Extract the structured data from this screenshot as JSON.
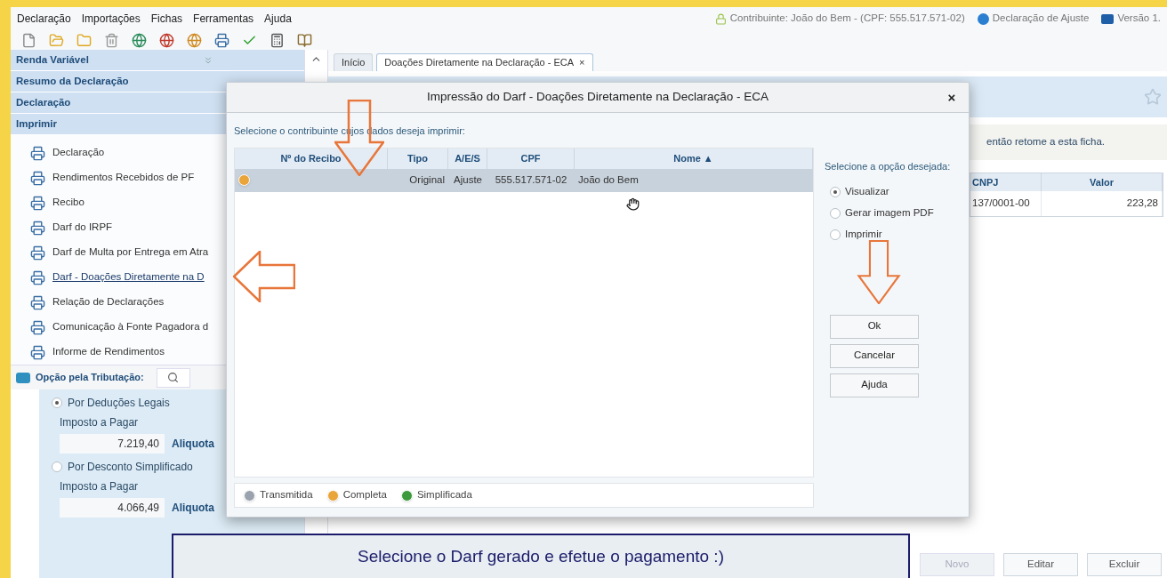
{
  "menu": [
    "Declaração",
    "Importações",
    "Fichas",
    "Ferramentas",
    "Ajuda"
  ],
  "header_info": [
    {
      "kind": "lock",
      "text": "Contribuinte: João do Bem - (CPF: 555.517.571-02)"
    },
    {
      "kind": "badge",
      "text": "Declaração de Ajuste"
    },
    {
      "kind": "version",
      "text": "Versão 1."
    }
  ],
  "sidebar": {
    "sections": [
      {
        "label": "Renda Variável",
        "collapsible": true
      },
      {
        "label": "Resumo da Declaração",
        "collapsible": false
      },
      {
        "label": "Declaração",
        "collapsible": false
      },
      {
        "label": "Imprimir",
        "collapsible": false
      }
    ],
    "items": [
      {
        "label": "Declaração",
        "selected": false
      },
      {
        "label": "Rendimentos Recebidos de PF",
        "selected": false
      },
      {
        "label": "Recibo",
        "selected": false
      },
      {
        "label": "Darf do IRPF",
        "selected": false
      },
      {
        "label": "Darf de Multa por Entrega em Atra",
        "selected": false
      },
      {
        "label": "Darf - Doações Diretamente na D",
        "selected": true
      },
      {
        "label": "Relação de Declarações",
        "selected": false
      },
      {
        "label": "Comunicação à Fonte Pagadora d",
        "selected": false
      },
      {
        "label": "Informe de Rendimentos",
        "selected": false
      }
    ]
  },
  "tributacao": {
    "label": "Opção pela Tributação:",
    "options": [
      {
        "label": "Por Deduções Legais",
        "selected": true,
        "field_label": "Imposto a Pagar",
        "value": "7.219,40",
        "rate": "Aliquota"
      },
      {
        "label": "Por Desconto Simplificado",
        "selected": false,
        "field_label": "Imposto a Pagar",
        "value": "4.066,49",
        "rate": "Aliquota"
      }
    ]
  },
  "tabs": [
    {
      "label": "Início",
      "selected": false
    },
    {
      "label": "Doações Diretamente na Declaração - ECA",
      "selected": true,
      "close": "×"
    }
  ],
  "main": {
    "note": "então retome a esta ficha.",
    "table": {
      "columns": [
        "CNPJ",
        "Valor"
      ],
      "rows": [
        [
          "137/0001-00",
          "223,28"
        ]
      ]
    },
    "buttons": [
      {
        "label": "Novo",
        "disabled": true
      },
      {
        "label": "Editar",
        "disabled": false
      },
      {
        "label": "Excluir",
        "disabled": false
      }
    ]
  },
  "dialog": {
    "title": "Impressão do Darf - Doações Diretamente na Declaração - ECA",
    "close": "×",
    "prompt": "Selecione o contribuinte cujos dados deseja imprimir:",
    "columns": [
      {
        "label": "Nº do Recibo"
      },
      {
        "label": "Tipo"
      },
      {
        "label": "A/E/S"
      },
      {
        "label": "CPF"
      },
      {
        "label": "Nome",
        "sort": "▲"
      }
    ],
    "rows": [
      {
        "kind": "completa",
        "tipo": "Original",
        "aes": "Ajuste",
        "cpf": "555.517.571-02",
        "nome": "João do Bem",
        "selected": true
      }
    ],
    "legend": [
      {
        "kind": "transmitida",
        "label": "Transmitida"
      },
      {
        "kind": "completa",
        "label": "Completa"
      },
      {
        "kind": "simplificada",
        "label": "Simplificada"
      }
    ],
    "options_label": "Selecione a opção desejada:",
    "options": [
      {
        "label": "Visualizar",
        "selected": true
      },
      {
        "label": "Gerar imagem PDF",
        "selected": false
      },
      {
        "label": "Imprimir",
        "selected": false
      }
    ],
    "buttons": [
      "Ok",
      "Cancelar",
      "Ajuda"
    ]
  },
  "caption": "Selecione o Darf gerado e efetue o pagamento :)"
}
